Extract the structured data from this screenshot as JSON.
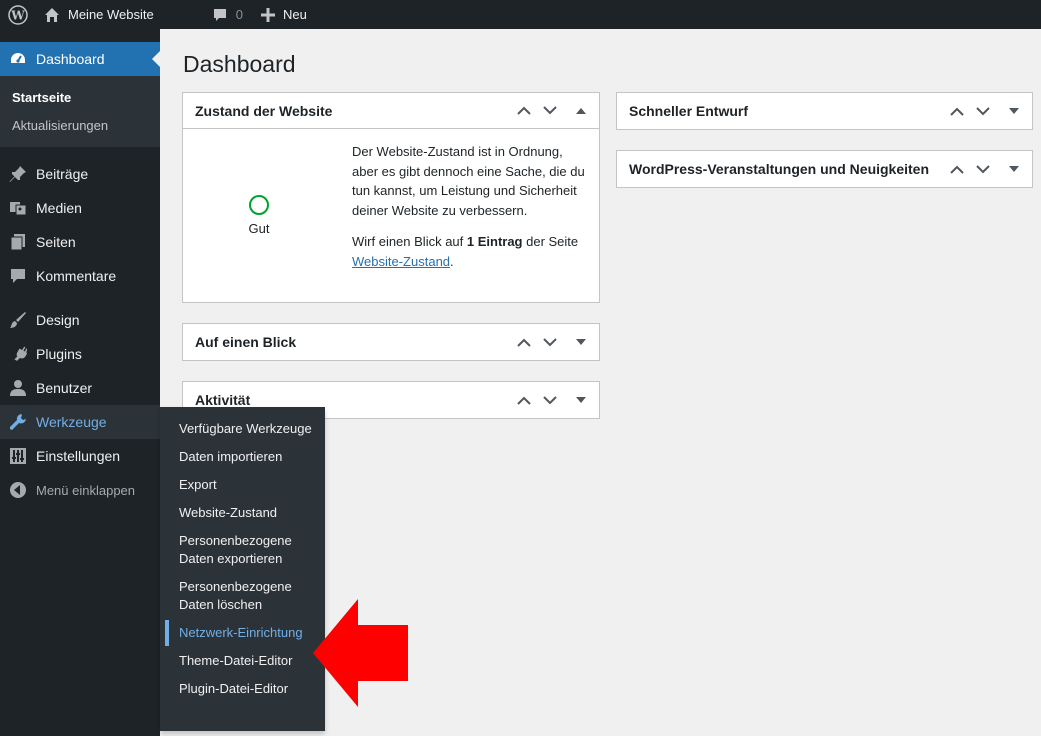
{
  "adminbar": {
    "site_name": "Meine Website",
    "comments_count": "0",
    "new_label": "Neu"
  },
  "sidebar": {
    "dashboard": "Dashboard",
    "dashboard_sub": [
      "Startseite",
      "Aktualisierungen"
    ],
    "items": [
      {
        "label": "Beiträge",
        "icon": "pin-icon"
      },
      {
        "label": "Medien",
        "icon": "media-icon"
      },
      {
        "label": "Seiten",
        "icon": "pages-icon"
      },
      {
        "label": "Kommentare",
        "icon": "comments-icon"
      },
      {
        "label": "Design",
        "icon": "brush-icon"
      },
      {
        "label": "Plugins",
        "icon": "plugin-icon"
      },
      {
        "label": "Benutzer",
        "icon": "user-icon"
      },
      {
        "label": "Werkzeuge",
        "icon": "wrench-icon"
      },
      {
        "label": "Einstellungen",
        "icon": "settings-icon"
      },
      {
        "label": "Menü einklappen",
        "icon": "collapse-icon"
      }
    ]
  },
  "flyout": {
    "items": [
      "Verfügbare Werkzeuge",
      "Daten importieren",
      "Export",
      "Website-Zustand",
      "Personenbezogene Daten exportieren",
      "Personenbezogene Daten löschen",
      "Netzwerk-Einrichtung",
      "Theme-Datei-Editor",
      "Plugin-Datei-Editor"
    ],
    "active": "Netzwerk-Einrichtung"
  },
  "main": {
    "title": "Dashboard",
    "health": {
      "title": "Zustand der Website",
      "status": "Gut",
      "text": "Der Website-Zustand ist in Ordnung, aber es gibt dennoch eine Sache, die du tun kannst, um Leistung und Sicherheit deiner Website zu verbessern.",
      "review_prefix": "Wirf einen Blick auf ",
      "review_count": "1 Eintrag",
      "review_mid": " der Seite ",
      "review_link": "Website-Zustand",
      "review_end": "."
    },
    "glance_title": "Auf einen Blick",
    "activity_title": "Aktivität",
    "quickdraft_title": "Schneller Entwurf",
    "events_title": "WordPress-Veranstaltungen und Neuigkeiten"
  },
  "colors": {
    "adminbar_bg": "#1d2327",
    "accent": "#2271b1",
    "highlight": "#72aee6",
    "arrow": "#ff0000",
    "status_good": "#00a32a"
  }
}
